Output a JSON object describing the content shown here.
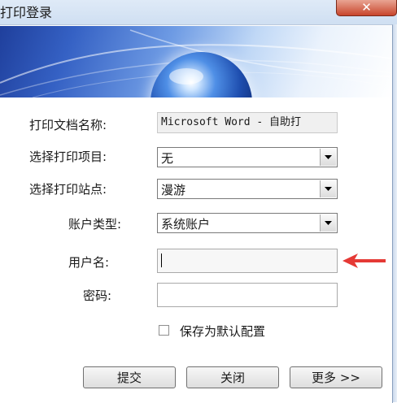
{
  "window": {
    "title": "打印登录",
    "close_symbol": "✕"
  },
  "form": {
    "doc_name_label": "打印文档名称:",
    "doc_name_value": "Microsoft Word - 自助打",
    "item_label": "选择打印项目:",
    "item_value": "无",
    "site_label": "选择打印站点:",
    "site_value": "漫游",
    "account_type_label": "账户类型:",
    "account_type_value": "系统账户",
    "username_label": "用户名:",
    "username_value": "",
    "password_label": "密码:",
    "password_value": "",
    "save_default_label": "保存为默认配置",
    "save_default_checked": false
  },
  "buttons": {
    "submit": "提交",
    "close": "关闭",
    "more": "更多 >>"
  },
  "colors": {
    "annotation_arrow": "#e53935",
    "banner_blue": "#2a56b8"
  },
  "icons": {
    "dropdown": "chevron-down-icon",
    "annotation": "red-arrow-icon"
  }
}
